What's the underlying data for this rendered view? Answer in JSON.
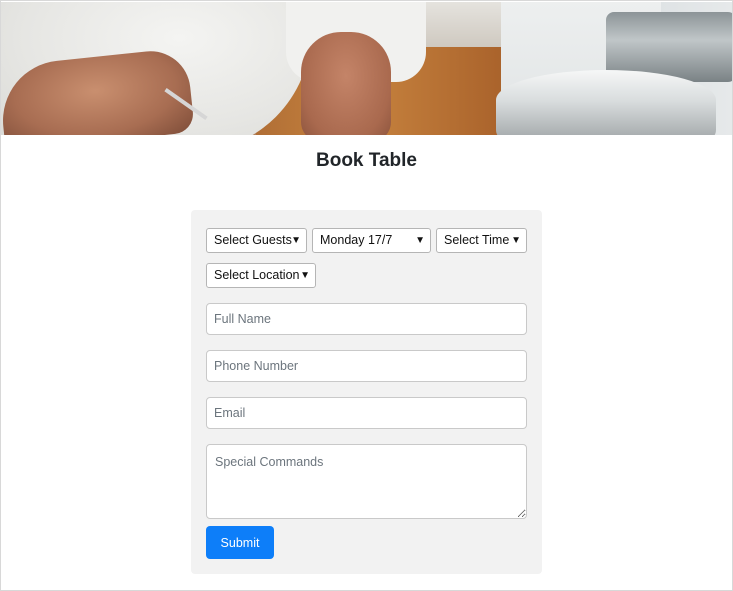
{
  "page": {
    "title": "Book Table"
  },
  "form": {
    "guests_select": {
      "selected": "Select Guests"
    },
    "date_select": {
      "selected": "Monday 17/7"
    },
    "time_select": {
      "selected": "Select Time"
    },
    "location_select": {
      "selected": "Select Location"
    },
    "full_name": {
      "placeholder": "Full Name",
      "value": ""
    },
    "phone_number": {
      "placeholder": "Phone Number",
      "value": ""
    },
    "email": {
      "placeholder": "Email",
      "value": ""
    },
    "special_commands": {
      "placeholder": "Special Commands",
      "value": ""
    },
    "submit_label": "Submit"
  },
  "colors": {
    "accent": "#0d7ef9",
    "card_background": "#f2f2f2"
  },
  "icons": {
    "dropdown": "chevron-down-icon"
  }
}
